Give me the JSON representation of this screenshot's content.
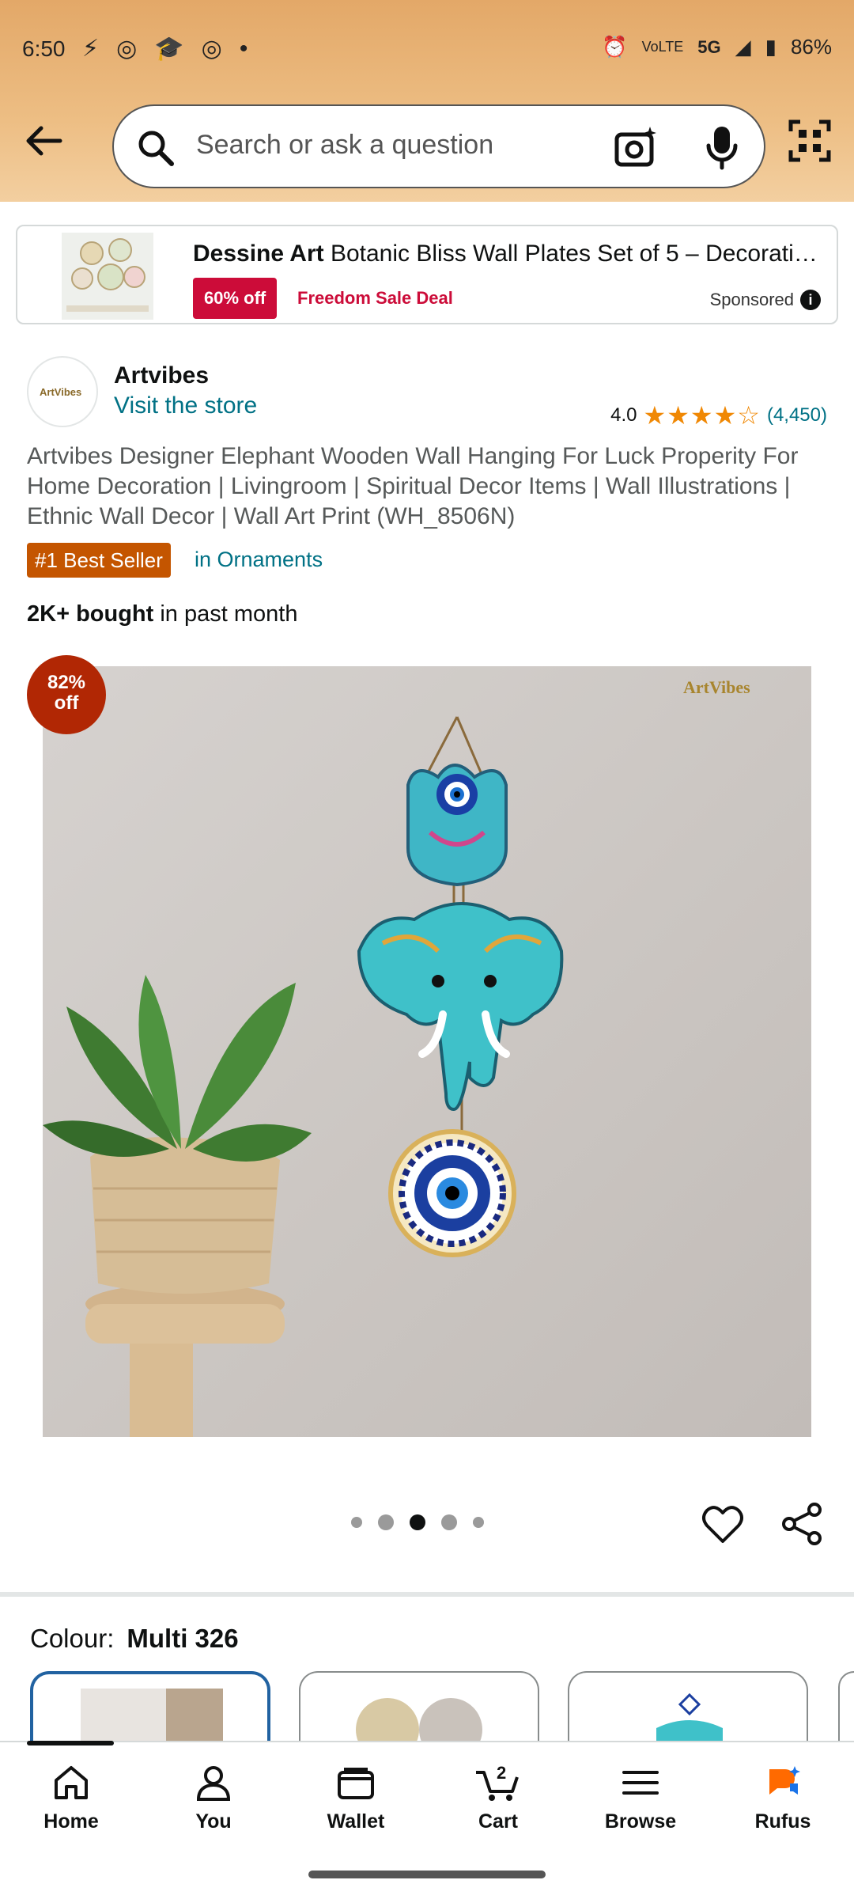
{
  "status_bar": {
    "time": "6:50",
    "battery": "86%",
    "network": "5G"
  },
  "search": {
    "placeholder": "Search or ask a question"
  },
  "sponsored_ad": {
    "brand": "Dessine Art",
    "title": "Botanic Bliss Wall Plates Set of 5 – Decorati…",
    "discount": "60% off",
    "deal": "Freedom Sale Deal",
    "label": "Sponsored"
  },
  "seller": {
    "name": "Artvibes",
    "link": "Visit the store",
    "logo_text": "ArtVibes"
  },
  "rating": {
    "value": "4.0",
    "stars": 4.0,
    "count": "(4,450)"
  },
  "product": {
    "title": "Artvibes Designer Elephant Wooden Wall Hanging For Luck Properity For Home Decoration | Livingroom | Spiritual Decor Items | Wall Illustrations | Ethnic Wall Decor | Wall Art Print (WH_8506N)",
    "badge": "#1 Best Seller",
    "badge_category": "in Ornaments",
    "bought_bold": "2K+ bought",
    "bought_rest": "in past month"
  },
  "image": {
    "discount_line1": "82%",
    "discount_line2": "off",
    "watermark": "ArtVibes"
  },
  "carousel": {
    "count": 5,
    "active_index": 2
  },
  "variant": {
    "label": "Colour:",
    "value": "Multi 326"
  },
  "nav": {
    "items": [
      {
        "label": "Home",
        "icon": "home-icon"
      },
      {
        "label": "You",
        "icon": "user-icon"
      },
      {
        "label": "Wallet",
        "icon": "wallet-icon"
      },
      {
        "label": "Cart",
        "icon": "cart-icon",
        "badge": "2"
      },
      {
        "label": "Browse",
        "icon": "menu-icon"
      },
      {
        "label": "Rufus",
        "icon": "rufus-icon"
      }
    ]
  },
  "colors": {
    "link": "#007185",
    "deal": "#cc0c39",
    "bestseller": "#c45500",
    "star": "#f08804"
  }
}
